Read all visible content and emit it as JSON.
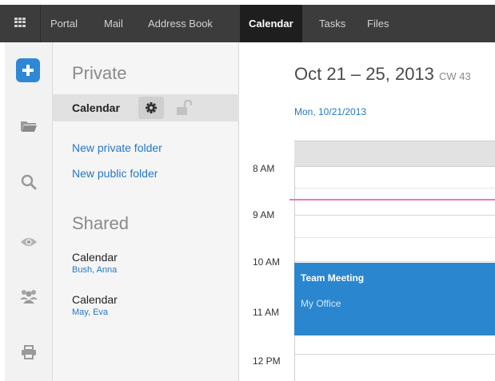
{
  "topnav": {
    "items": [
      {
        "label": "Portal"
      },
      {
        "label": "Mail"
      },
      {
        "label": "Address Book"
      },
      {
        "label": "Calendar",
        "active": true
      },
      {
        "label": "Tasks"
      },
      {
        "label": "Files"
      }
    ]
  },
  "rail": {
    "icons": [
      "plus-icon",
      "folder-icon",
      "search-icon",
      "eye-icon",
      "people-icon",
      "printer-icon"
    ]
  },
  "folders": {
    "private": {
      "title": "Private",
      "selected": "Calendar",
      "links": [
        "New private folder",
        "New public folder"
      ]
    },
    "shared": {
      "title": "Shared",
      "items": [
        {
          "name": "Calendar",
          "owner": "Bush, Anna"
        },
        {
          "name": "Calendar",
          "owner": "May, Eva"
        }
      ]
    }
  },
  "calendar": {
    "range": "Oct 21 – 25, 2013",
    "week": "CW 43",
    "day_header": "Mon, 10/21/2013",
    "hours": [
      "8 AM",
      "9 AM",
      "10 AM",
      "11 AM",
      "12 PM"
    ],
    "event": {
      "title": "Team Meeting",
      "location": "My Office",
      "color": "#2a86cf"
    }
  },
  "colors": {
    "accent": "#2f88d5",
    "link": "#2478c8",
    "now_line": "#e879c8",
    "topbar": "#3c3c3c"
  }
}
